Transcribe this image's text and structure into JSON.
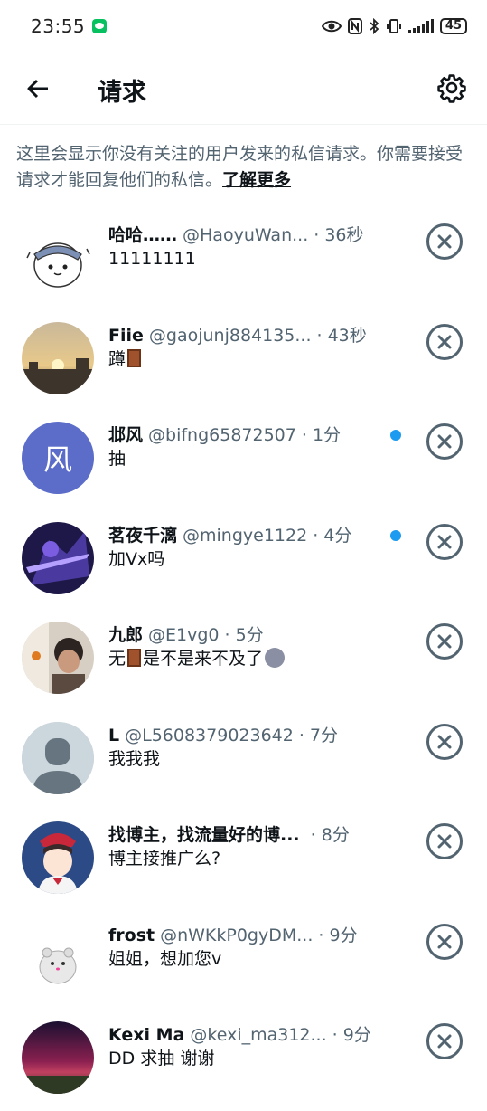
{
  "status": {
    "time": "23:55",
    "battery": "45"
  },
  "header": {
    "title": "请求"
  },
  "notice": {
    "text": "这里会显示你没有关注的用户发来的私信请求。你需要接受请求才能回复他们的私信。",
    "link": "了解更多"
  },
  "requests": [
    {
      "name": "哈哈……",
      "handle": "@HaoyuWan...",
      "time": "· 36秒",
      "message": "11111111",
      "unread": false
    },
    {
      "name": "Fiie",
      "handle": "@gaojunj884135...",
      "time": "· 43秒",
      "message": "蹲",
      "unread": false
    },
    {
      "name": "邶风",
      "handle": "@bifng65872507",
      "time": "· 1分",
      "message": "抽",
      "unread": true,
      "avatar_letter": "风"
    },
    {
      "name": "茗夜千漓",
      "handle": "@mingye1122",
      "time": "· 4分",
      "message": "加Vx吗",
      "unread": true
    },
    {
      "name": "九郎",
      "handle": "@E1vg0",
      "time": "· 5分",
      "message_pre": "无",
      "message_post": "是不是来不及了",
      "unread": false
    },
    {
      "name": "L",
      "handle": "@L5608379023642",
      "time": "· 7分",
      "message": "我我我",
      "unread": false
    },
    {
      "name": "找博主，找流量好的博...",
      "handle": "",
      "time": "· 8分",
      "message": "博主接推广么?",
      "unread": false
    },
    {
      "name": "frost",
      "handle": "@nWKkP0gyDM...",
      "time": "· 9分",
      "message": "姐姐，想加您v",
      "unread": false
    },
    {
      "name": "Kexi Ma",
      "handle": "@kexi_ma312...",
      "time": "· 9分",
      "message": "DD 求抽 谢谢",
      "unread": false
    }
  ],
  "icons": {
    "back": "arrow-left-icon",
    "settings": "gear-icon",
    "dismiss": "close-circle-icon"
  },
  "colors": {
    "accent": "#1d9bf0",
    "secondary": "#536471",
    "avatar_feng": "#5b6dc8"
  }
}
